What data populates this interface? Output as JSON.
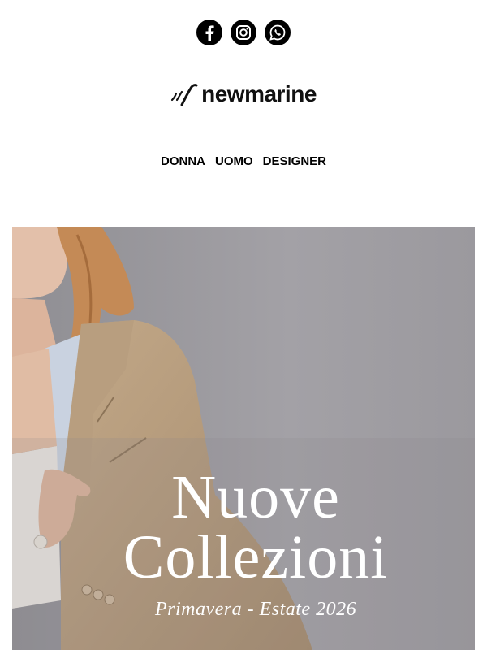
{
  "social": [
    {
      "name": "facebook",
      "icon": "facebook-icon"
    },
    {
      "name": "instagram",
      "icon": "instagram-icon"
    },
    {
      "name": "whatsapp",
      "icon": "whatsapp-icon"
    }
  ],
  "brand": {
    "name": "newmarine",
    "logo_icon": "newmarine-logo-mark"
  },
  "nav": {
    "donna": "DONNA",
    "uomo": "UOMO",
    "designer": "DESIGNER"
  },
  "hero": {
    "title_line1": "Nuove",
    "title_line2": "Collezioni",
    "subtitle": "Primavera - Estate 2026",
    "background_color": "#9e9da2",
    "jacket_color": "#b59b7d"
  }
}
